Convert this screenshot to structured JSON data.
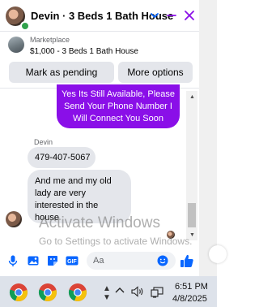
{
  "header": {
    "title": "Devin · 3 Beds 1 Bath House"
  },
  "listing": {
    "label": "Marketplace",
    "detail": "$1,000 - 3 Beds 1 Bath House",
    "mark_pending": "Mark as pending",
    "more_options": "More options"
  },
  "messages": {
    "sent_lines": [
      "Yes Its Still Available, Please",
      "Send Your Phone Number I",
      "Will Connect You Soon"
    ],
    "sender_name": "Devin",
    "phone": "479-407-5067",
    "received_lines": [
      "And me and my old",
      "lady are very",
      "interested in the",
      "house"
    ]
  },
  "composer": {
    "placeholder": "Aa"
  },
  "watermark": {
    "title": "Activate Windows",
    "subtitle": "Go to Settings to activate Windows."
  },
  "taskbar": {
    "time": "6:51 PM",
    "date": "4/8/2025"
  },
  "colors": {
    "accent": "#0866ff",
    "sent_bubble": "#8a0fe8",
    "online": "#31a24c"
  }
}
